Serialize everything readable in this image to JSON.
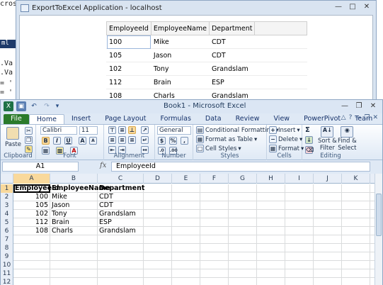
{
  "background_editor": {
    "lines": [
      "croso",
      "ml ▶",
      ".Va",
      ".Va",
      "= '",
      "= '"
    ]
  },
  "browser": {
    "title": "ExportToExcel Application - localhost",
    "grid": {
      "headers": [
        "EmployeeId",
        "EmployeeName",
        "Department"
      ],
      "rows": [
        [
          "100",
          "Mike",
          "CDT"
        ],
        [
          "105",
          "Jason",
          "CDT"
        ],
        [
          "102",
          "Tony",
          "Grandslam"
        ],
        [
          "112",
          "Brain",
          "ESP"
        ],
        [
          "108",
          "Charls",
          "Grandslam"
        ]
      ]
    }
  },
  "excel": {
    "title": "Book1 - Microsoft Excel",
    "tabs": [
      "File",
      "Home",
      "Insert",
      "Page Layout",
      "Formulas",
      "Data",
      "Review",
      "View",
      "PowerPivot",
      "Team"
    ],
    "ribbon": {
      "clipboard": {
        "label": "Clipboard",
        "paste": "Paste"
      },
      "font": {
        "label": "Font",
        "name": "Calibri",
        "size": "11",
        "bold": "B",
        "italic": "I",
        "underline": "U",
        "grow": "A",
        "shrink": "A",
        "fontcolor": "A"
      },
      "alignment": {
        "label": "Alignment"
      },
      "number": {
        "label": "Number",
        "format": "General",
        "currency": "$",
        "percent": "%"
      },
      "styles": {
        "label": "Styles",
        "conditional": "Conditional Formatting",
        "table": "Format as Table",
        "cell": "Cell Styles"
      },
      "cells": {
        "label": "Cells",
        "insert": "Insert",
        "delete": "Delete",
        "format": "Format"
      },
      "editing": {
        "label": "Editing",
        "sigma": "Σ",
        "sort": "Sort &",
        "sort2": "Filter",
        "find": "Find &",
        "find2": "Select"
      }
    },
    "formula_bar": {
      "name_box": "A1",
      "fx": "fx",
      "content": "EmployeeId"
    },
    "columns": [
      "A",
      "B",
      "C",
      "D",
      "E",
      "F",
      "G",
      "H",
      "I",
      "J",
      "K"
    ],
    "rows": [
      [
        "EmployeeId",
        "EmployeeName",
        "Department"
      ],
      [
        "100",
        "Mike",
        "CDT"
      ],
      [
        "105",
        "Jason",
        "CDT"
      ],
      [
        "102",
        "Tony",
        "Grandslam"
      ],
      [
        "112",
        "Brain",
        "ESP"
      ],
      [
        "108",
        "Charls",
        "Grandslam"
      ],
      [
        "",
        "",
        ""
      ],
      [
        "",
        "",
        ""
      ],
      [
        "",
        "",
        ""
      ],
      [
        "",
        "",
        ""
      ],
      [
        "",
        "",
        ""
      ],
      [
        "",
        "",
        ""
      ]
    ],
    "row_numbers": [
      "1",
      "2",
      "3",
      "4",
      "5",
      "6",
      "7",
      "8",
      "9",
      "10",
      "11",
      "12"
    ]
  }
}
